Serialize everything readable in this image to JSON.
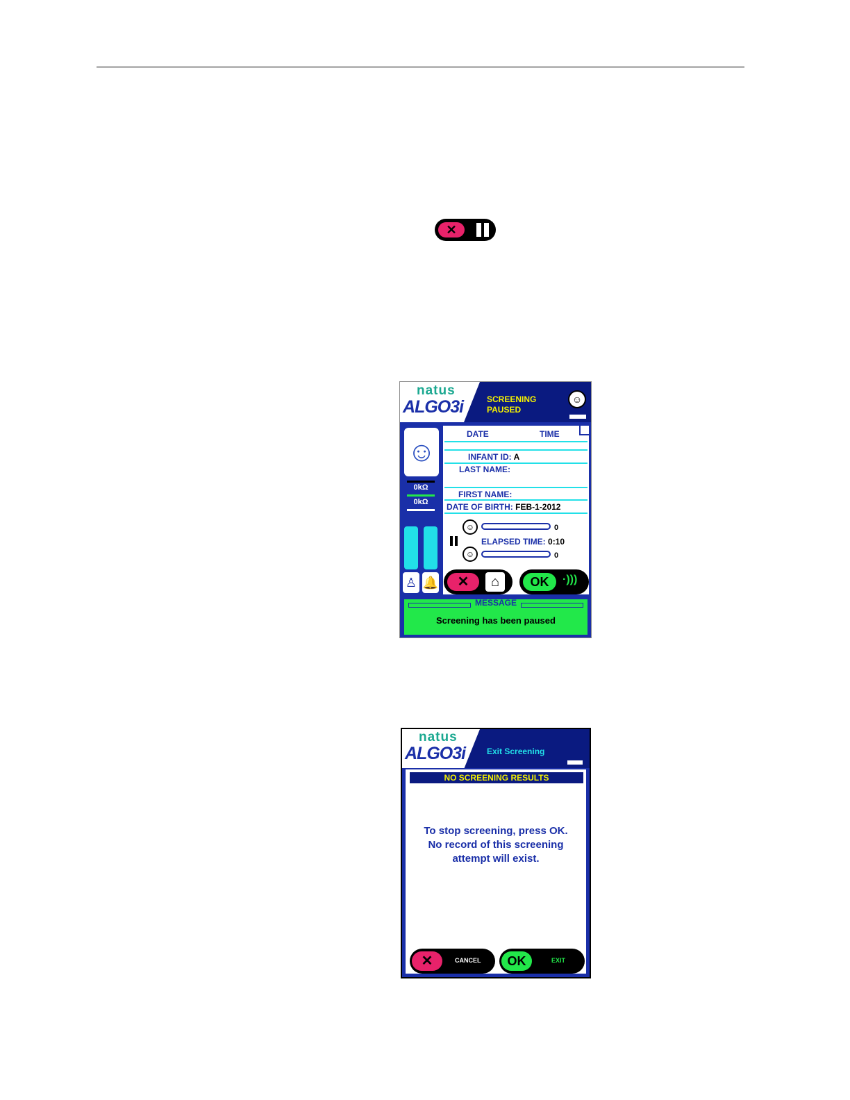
{
  "screen1": {
    "brand": {
      "top": "natus",
      "bottom": "ALGO3i"
    },
    "header_status": [
      "SCREENING",
      "PAUSED"
    ],
    "impedance": [
      "0kΩ",
      "0kΩ"
    ],
    "fields": {
      "date_label": "DATE",
      "time_label": "TIME",
      "infant_id_label": "INFANT ID:",
      "infant_id_value": "A",
      "last_name_label": "LAST NAME:",
      "first_name_label": "FIRST NAME:",
      "dob_label": "DATE OF BIRTH:",
      "dob_value": "FEB-1-2012"
    },
    "progress": {
      "ear1_value": "0",
      "ear2_value": "0",
      "ear1_fraction": 0,
      "ear2_fraction": 0
    },
    "elapsed_label": "ELAPSED TIME:",
    "elapsed_value": "0:10",
    "ok_label": "OK",
    "message_title": "MESSAGE",
    "message_text": "Screening has been paused"
  },
  "screen2": {
    "brand": {
      "top": "natus",
      "bottom": "ALGO3i"
    },
    "header_title": "Exit Screening",
    "banner": "NO SCREENING RESULTS",
    "message_lines": [
      "To stop screening, press OK.",
      "No record of this screening",
      "attempt will exist."
    ],
    "cancel_label": "CANCEL",
    "ok_label": "OK",
    "exit_label": "EXIT"
  },
  "colors": {
    "brand_blue": "#1a2fa8",
    "cancel_red": "#e8226a",
    "ok_green": "#22e84a",
    "cyan": "#22e0e8",
    "banner_yellow": "#f4f000"
  }
}
